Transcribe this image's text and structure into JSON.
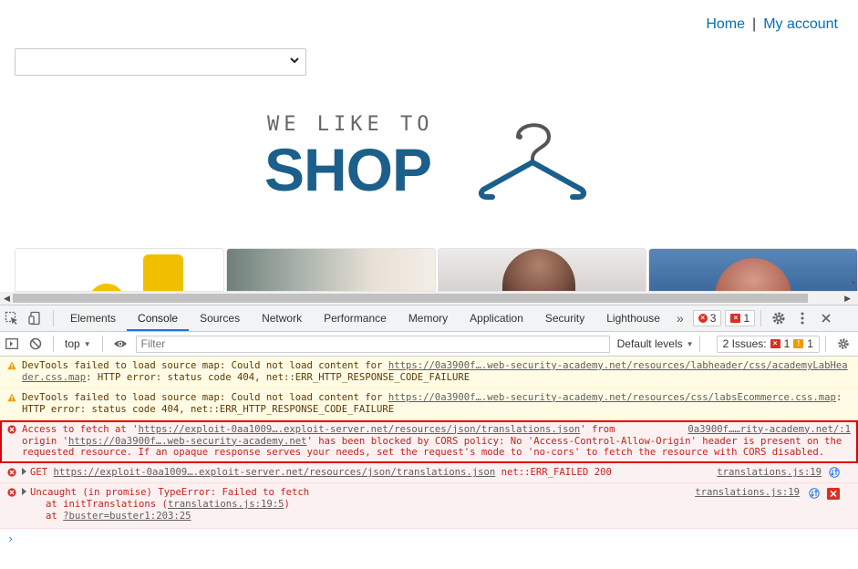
{
  "page": {
    "nav": {
      "home": "Home",
      "separator": "|",
      "account": "My account"
    },
    "logo": {
      "tagline": "WE LIKE TO",
      "brand": "SHOP"
    }
  },
  "devtools": {
    "tabs": [
      "Elements",
      "Console",
      "Sources",
      "Network",
      "Performance",
      "Memory",
      "Application",
      "Security",
      "Lighthouse"
    ],
    "more": "»",
    "error_count": "3",
    "issue_count": "1",
    "toolbar": {
      "context": "top",
      "filter_placeholder": "Filter",
      "levels": "Default levels",
      "issues_label": "2 Issues:",
      "issues_errors": "1",
      "issues_warnings": "1"
    },
    "messages": [
      {
        "level": "warning",
        "text": "DevTools failed to load source map: Could not load content for ",
        "link": "https://0a3900f….web-security-academy.net/resources/labheader/css/academyLabHeader.css.map",
        "tail": ": HTTP error: status code 404, net::ERR_HTTP_RESPONSE_CODE_FAILURE"
      },
      {
        "level": "warning",
        "text": "DevTools failed to load source map: Could not load content for ",
        "link": "https://0a3900f….web-security-academy.net/resources/css/labsEcommerce.css.map",
        "tail": ": HTTP error: status code 404, net::ERR_HTTP_RESPONSE_CODE_FAILURE"
      },
      {
        "level": "error",
        "p1": "Access to fetch at '",
        "url1": "https://exploit-0aa1009….exploit-server.net/resources/json/translations.json",
        "p2": "' from",
        "source": "0a3900f……rity-academy.net/:1",
        "p3": "origin '",
        "url2": "https://0a3900f….web-security-academy.net",
        "p4": "' has been blocked by CORS policy: No 'Access-Control-Allow-Origin' header is present on the requested resource. If an opaque response serves your needs, set the request's mode to 'no-cors' to fetch the resource with CORS disabled."
      },
      {
        "level": "error",
        "method": "GET",
        "url": "https://exploit-0aa1009….exploit-server.net/resources/json/translations.json",
        "tail": " net::ERR_FAILED 200",
        "source": "translations.js:19"
      },
      {
        "level": "error",
        "text": "Uncaught (in promise) TypeError: Failed to fetch",
        "stack1_prefix": "at initTranslations (",
        "stack1_link": "translations.js:19:5",
        "stack1_suffix": ")",
        "stack2_prefix": "at ",
        "stack2_link": "?buster=buster1:203:25",
        "source": "translations.js:19"
      }
    ],
    "prompt": "›"
  },
  "colors": {
    "brand": "#1b5f8a",
    "link": "#0070b8",
    "error": "#c5221f",
    "highlight": "#e00000"
  }
}
